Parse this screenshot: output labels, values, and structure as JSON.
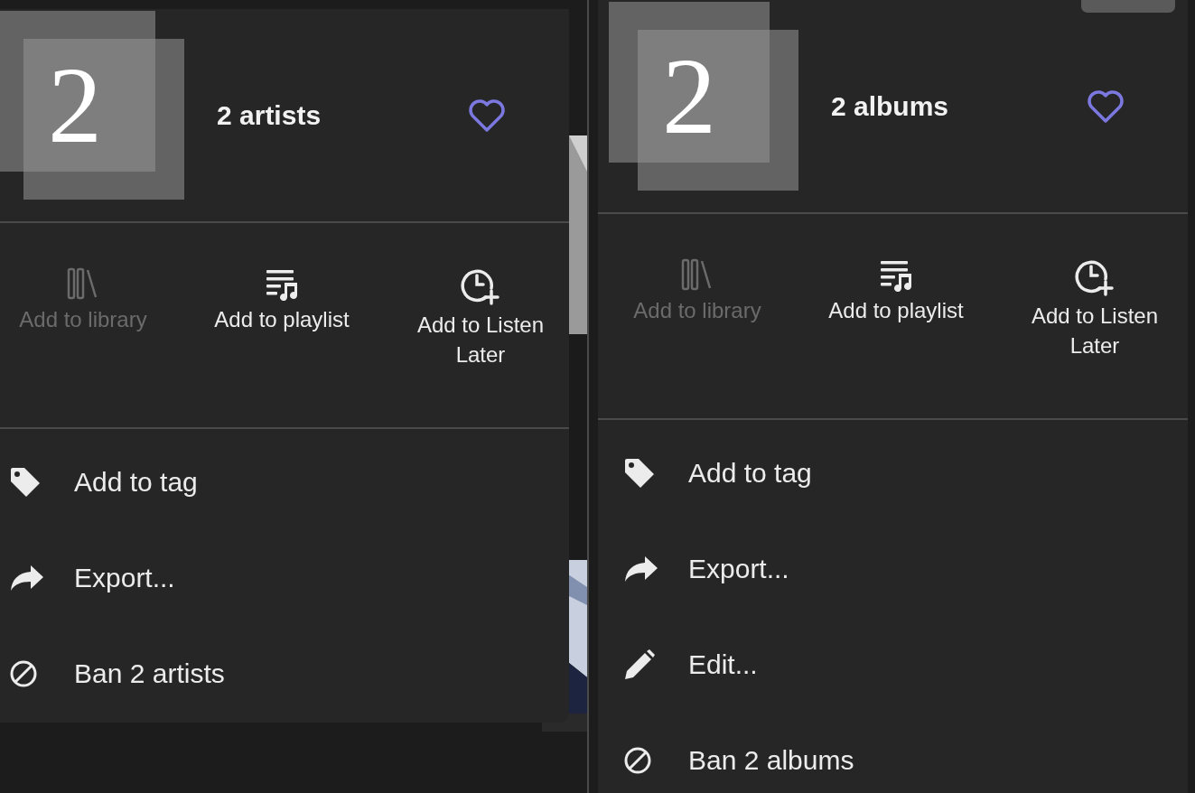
{
  "panels": [
    {
      "cover_number": "2",
      "title": "2 artists",
      "handle": false,
      "actions": [
        {
          "kind": "library",
          "label": "Add to library",
          "disabled": true
        },
        {
          "kind": "playlist",
          "label": "Add to playlist",
          "disabled": false
        },
        {
          "kind": "listen-later",
          "label": "Add to Listen Later",
          "disabled": false
        }
      ],
      "items": [
        {
          "kind": "tag",
          "label": "Add to tag"
        },
        {
          "kind": "export",
          "label": "Export..."
        },
        {
          "kind": "ban",
          "label": "Ban 2 artists"
        }
      ]
    },
    {
      "cover_number": "2",
      "title": "2 albums",
      "handle": true,
      "actions": [
        {
          "kind": "library",
          "label": "Add to library",
          "disabled": true
        },
        {
          "kind": "playlist",
          "label": "Add to playlist",
          "disabled": false
        },
        {
          "kind": "listen-later",
          "label": "Add to Listen Later",
          "disabled": false
        }
      ],
      "items": [
        {
          "kind": "tag",
          "label": "Add to tag"
        },
        {
          "kind": "export",
          "label": "Export..."
        },
        {
          "kind": "edit",
          "label": "Edit..."
        },
        {
          "kind": "ban",
          "label": "Ban 2 albums"
        }
      ]
    }
  ]
}
